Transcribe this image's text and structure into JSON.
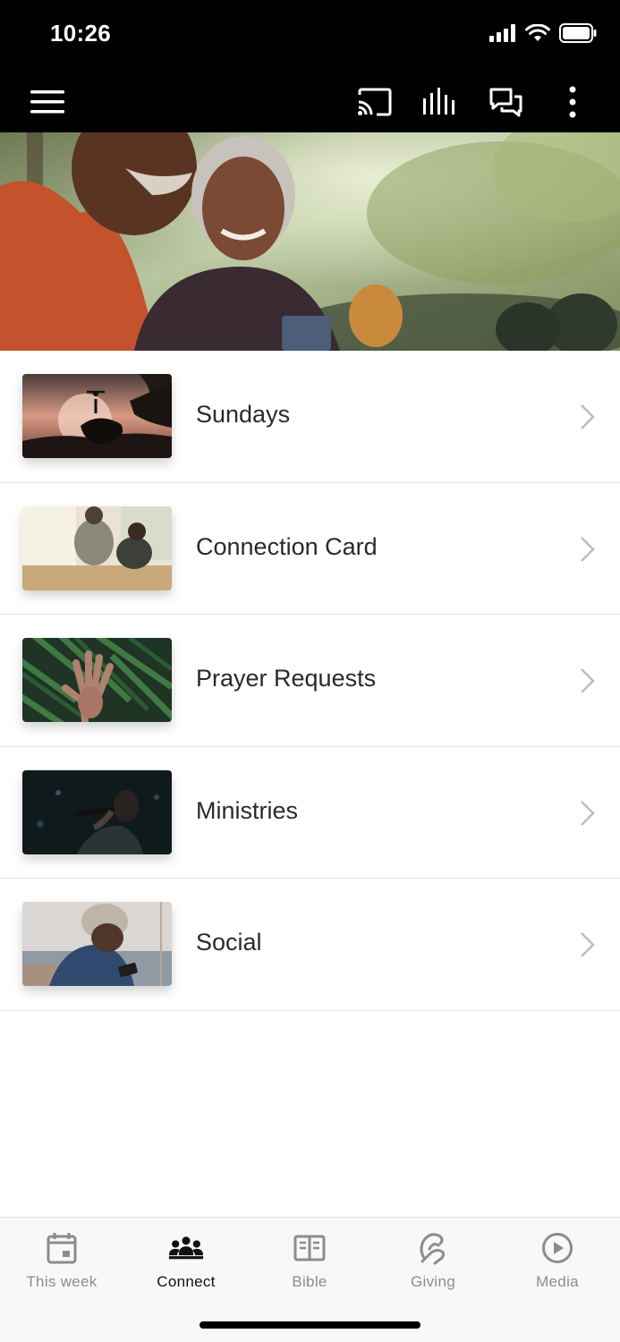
{
  "status_bar": {
    "time": "10:26"
  },
  "toolbar": {
    "icons": [
      "menu-icon",
      "cast-icon",
      "audio-icon",
      "chat-icon",
      "more-icon"
    ]
  },
  "list": {
    "items": [
      {
        "label": "Sundays"
      },
      {
        "label": "Connection Card"
      },
      {
        "label": "Prayer Requests"
      },
      {
        "label": "Ministries"
      },
      {
        "label": "Social"
      }
    ]
  },
  "bottom_nav": {
    "items": [
      {
        "label": "This week",
        "icon": "calendar-icon"
      },
      {
        "label": "Connect",
        "icon": "people-icon",
        "active": true
      },
      {
        "label": "Bible",
        "icon": "book-icon"
      },
      {
        "label": "Giving",
        "icon": "giving-icon"
      },
      {
        "label": "Media",
        "icon": "play-icon"
      }
    ]
  },
  "colors": {
    "bar_bg": "#000000",
    "active": "#111111",
    "inactive": "#8c8c8c",
    "divider": "#e3e3e3"
  }
}
